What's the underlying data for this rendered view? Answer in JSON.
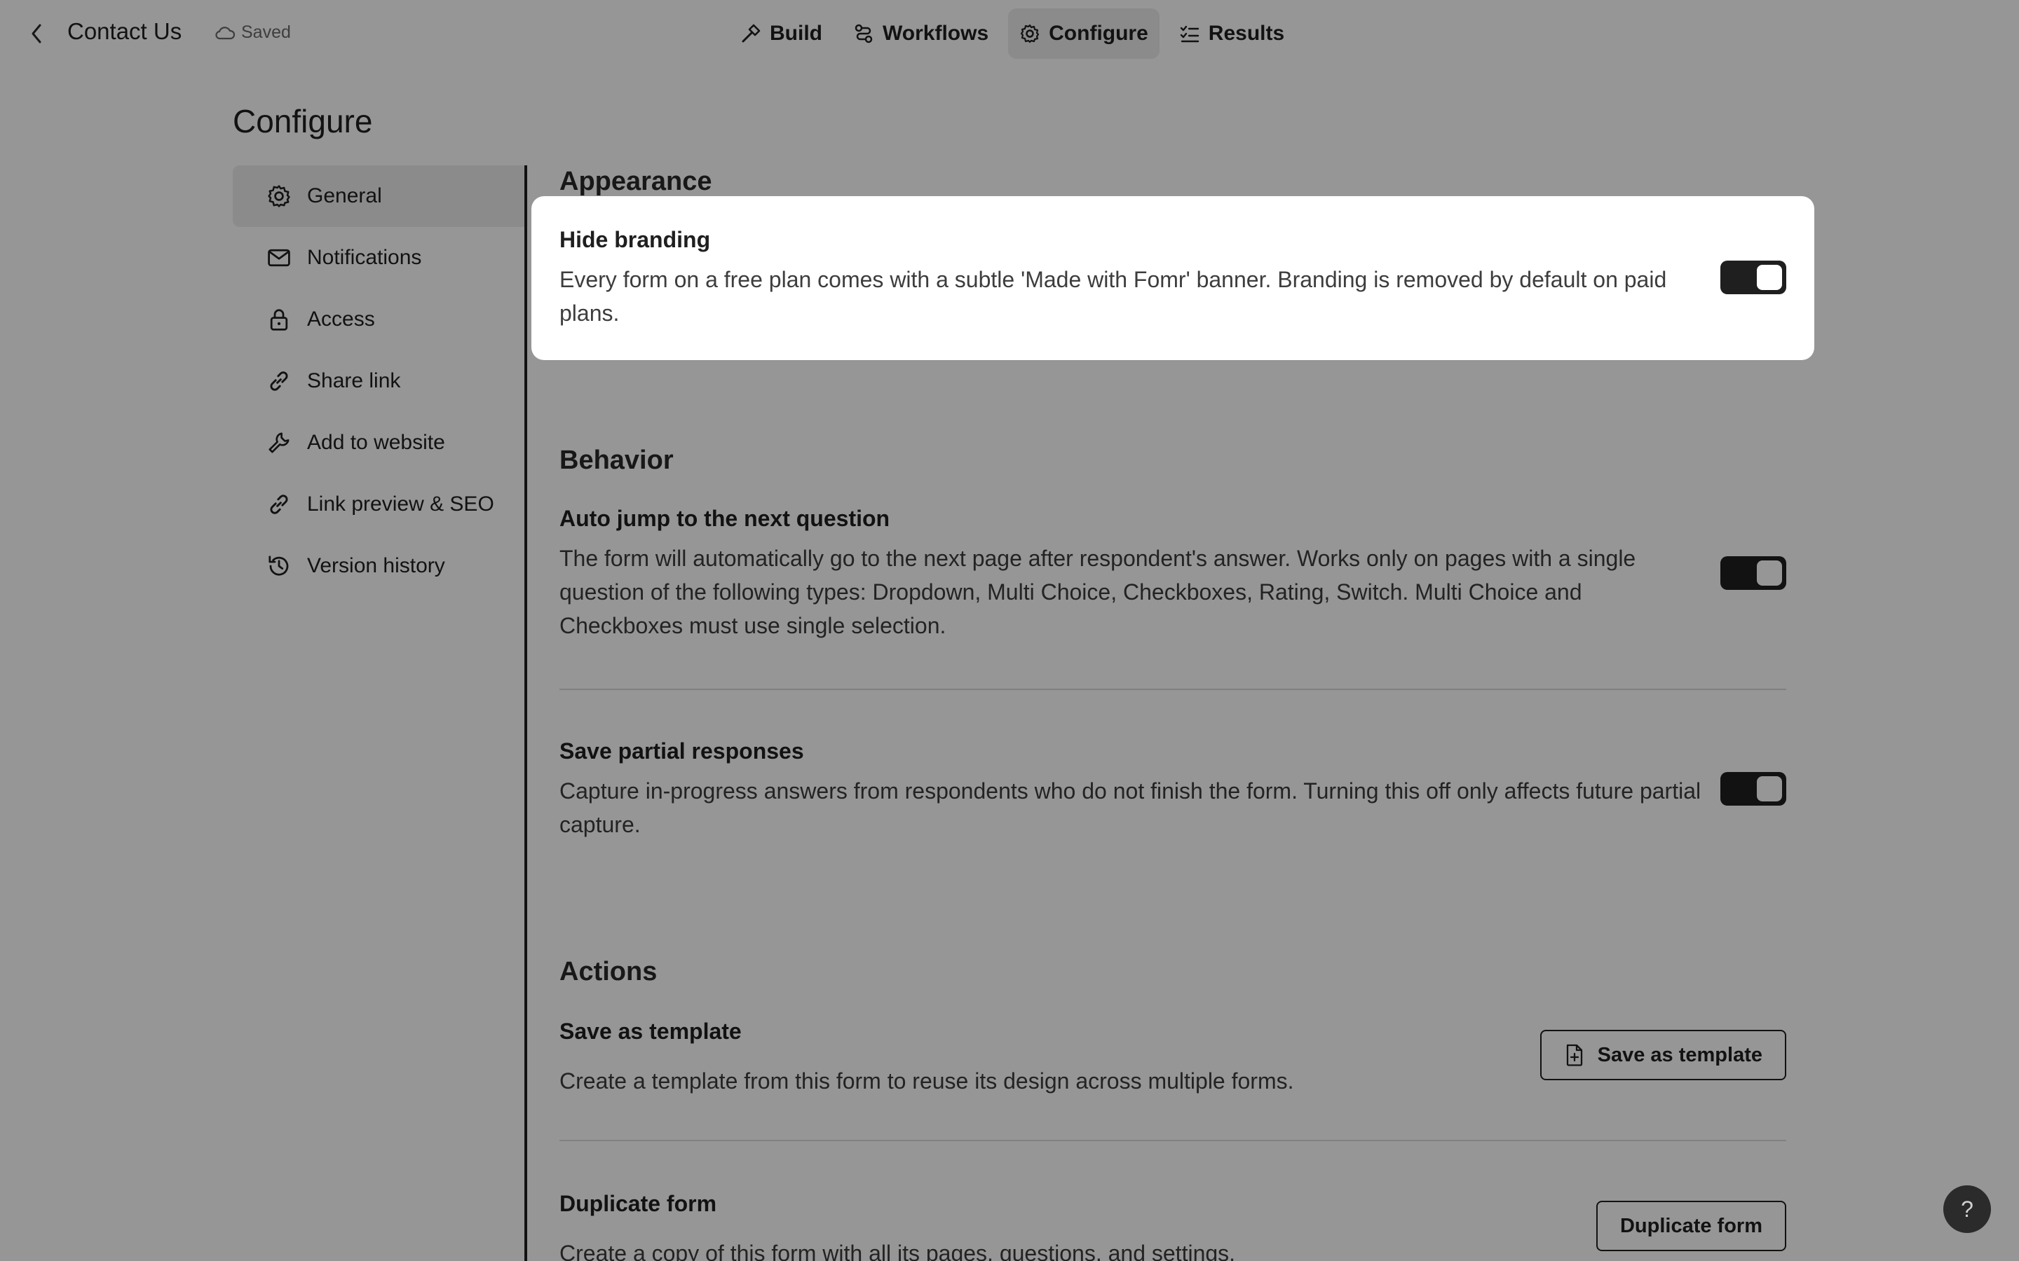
{
  "header": {
    "form_title": "Contact Us",
    "save_status": "Saved",
    "tabs": [
      {
        "label": "Build",
        "icon": "hammer-icon",
        "active": false
      },
      {
        "label": "Workflows",
        "icon": "workflow-icon",
        "active": false
      },
      {
        "label": "Configure",
        "icon": "gear-icon",
        "active": true
      },
      {
        "label": "Results",
        "icon": "list-check-icon",
        "active": false
      }
    ]
  },
  "page": {
    "title": "Configure"
  },
  "sidebar": {
    "items": [
      {
        "label": "General",
        "icon": "gear-icon",
        "active": true
      },
      {
        "label": "Notifications",
        "icon": "mail-icon",
        "active": false
      },
      {
        "label": "Access",
        "icon": "lock-icon",
        "active": false
      },
      {
        "label": "Share link",
        "icon": "link-icon",
        "active": false
      },
      {
        "label": "Add to website",
        "icon": "wrench-icon",
        "active": false
      },
      {
        "label": "Link preview & SEO",
        "icon": "link-icon",
        "active": false
      },
      {
        "label": "Version history",
        "icon": "history-icon",
        "active": false
      }
    ]
  },
  "appearance": {
    "section_title": "Appearance",
    "hide_branding": {
      "title": "Hide branding",
      "description": "Every form on a free plan comes with a subtle 'Made with Fomr' banner. Branding is removed by default on paid plans.",
      "enabled": true
    }
  },
  "behavior": {
    "section_title": "Behavior",
    "auto_jump": {
      "title": "Auto jump to the next question",
      "description": "The form will automatically go to the next page after respondent's answer. Works only on pages with a single question of the following types: Dropdown, Multi Choice, Checkboxes, Rating, Switch. Multi Choice and Checkboxes must use single selection.",
      "enabled": true
    },
    "partial_responses": {
      "title": "Save partial responses",
      "description": "Capture in-progress answers from respondents who do not finish the form. Turning this off only affects future partial capture.",
      "enabled": true
    }
  },
  "actions": {
    "section_title": "Actions",
    "save_template": {
      "title": "Save as template",
      "description": "Create a template from this form to reuse its design across multiple forms.",
      "button_label": "Save as template"
    },
    "duplicate": {
      "title": "Duplicate form",
      "description": "Create a copy of this form with all its pages, questions, and settings.",
      "button_label": "Duplicate form"
    }
  },
  "help": {
    "label": "?"
  },
  "colors": {
    "accent": "#1f1f1f",
    "overlay": "#000000",
    "active_bg": "#ececec"
  }
}
